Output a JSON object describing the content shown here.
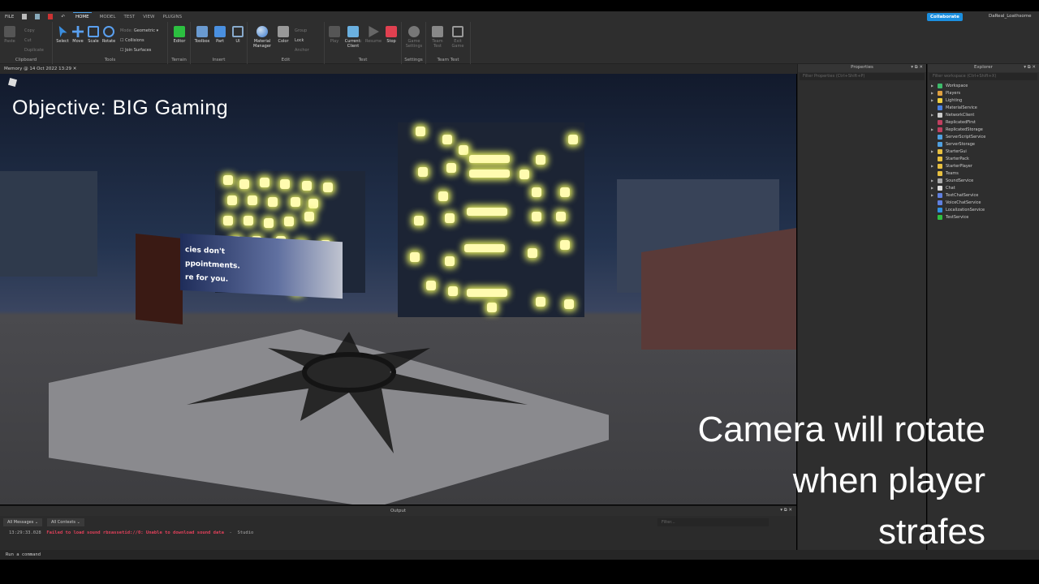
{
  "menubar": {
    "file": "FILE",
    "tabs": [
      "HOME",
      "MODEL",
      "TEST",
      "VIEW",
      "PLUGINS"
    ],
    "active": "HOME"
  },
  "ribbon": {
    "clipboard": {
      "label": "Clipboard",
      "paste": "Paste",
      "copy": "Copy",
      "cut": "Cut",
      "duplicate": "Duplicate"
    },
    "tools": {
      "label": "Tools",
      "select": "Select",
      "move": "Move",
      "scale": "Scale",
      "rotate": "Rotate",
      "mode_label": "Mode:",
      "mode_value": "Geometric",
      "collisions": "Collisions",
      "join_surfaces": "Join Surfaces"
    },
    "terrain": {
      "label": "Terrain",
      "editor": "Editor"
    },
    "insert": {
      "label": "Insert",
      "toolbox": "Toolbox",
      "part": "Part",
      "ui": "UI"
    },
    "edit": {
      "label": "Edit",
      "material": "Material Manager",
      "color": "Color",
      "group": "Group",
      "lock": "Lock",
      "anchor": "Anchor"
    },
    "test": {
      "label": "Test",
      "play": "Play",
      "current": "Current: Client",
      "resume": "Resume",
      "stop": "Stop"
    },
    "settings": {
      "label": "Settings",
      "game_settings": "Game Settings"
    },
    "teamtest": {
      "label": "Team Test",
      "team_test": "Team Test",
      "exit_game": "Exit Game"
    }
  },
  "topright": {
    "collaborate": "Collaborate",
    "user": "DaReal_Loathsome"
  },
  "doc_tab": "Memory @ 14 Oct 2022 13:29",
  "viewport": {
    "objective": "Objective: BIG Gaming",
    "poster_lines": [
      "cies don't",
      "ppointments.",
      "re for you."
    ]
  },
  "properties": {
    "title": "Properties",
    "filter": "Filter Properties (Ctrl+Shift+P)"
  },
  "explorer": {
    "title": "Explorer",
    "filter": "Filter workspace (Ctrl+Shift+X)",
    "items": [
      {
        "name": "Workspace",
        "exp": true,
        "color": "#3dbb6a"
      },
      {
        "name": "Players",
        "exp": true,
        "color": "#e0a040"
      },
      {
        "name": "Lighting",
        "exp": true,
        "color": "#f0d040"
      },
      {
        "name": "MaterialService",
        "exp": false,
        "color": "#4a80e0"
      },
      {
        "name": "NetworkClient",
        "exp": true,
        "color": "#cccccc"
      },
      {
        "name": "ReplicatedFirst",
        "exp": false,
        "color": "#c04060"
      },
      {
        "name": "ReplicatedStorage",
        "exp": true,
        "color": "#c04060"
      },
      {
        "name": "ServerScriptService",
        "exp": false,
        "color": "#50a0e0"
      },
      {
        "name": "ServerStorage",
        "exp": false,
        "color": "#50a0e0"
      },
      {
        "name": "StarterGui",
        "exp": true,
        "color": "#e8c040"
      },
      {
        "name": "StarterPack",
        "exp": false,
        "color": "#e8c040"
      },
      {
        "name": "StarterPlayer",
        "exp": true,
        "color": "#e8c040"
      },
      {
        "name": "Teams",
        "exp": false,
        "color": "#e8c040"
      },
      {
        "name": "SoundService",
        "exp": true,
        "color": "#aaaaaa"
      },
      {
        "name": "Chat",
        "exp": true,
        "color": "#dddddd"
      },
      {
        "name": "TextChatService",
        "exp": true,
        "color": "#6080e0"
      },
      {
        "name": "VoiceChatService",
        "exp": false,
        "color": "#6080e0"
      },
      {
        "name": "LocalizationService",
        "exp": false,
        "color": "#3090e0"
      },
      {
        "name": "TestService",
        "exp": false,
        "color": "#30c040"
      }
    ]
  },
  "output": {
    "title": "Output",
    "filter_messages": "All Messages",
    "filter_contexts": "All Contexts",
    "search_placeholder": "Filter...",
    "log": {
      "time": "13:29:33.028",
      "message": "Failed to load sound rbxassetid://0: Unable to download sound data",
      "sep": "-",
      "source": "Studio"
    }
  },
  "command": {
    "placeholder": "Run a command"
  },
  "caption": [
    "Camera will rotate",
    "when player",
    "strafes"
  ]
}
